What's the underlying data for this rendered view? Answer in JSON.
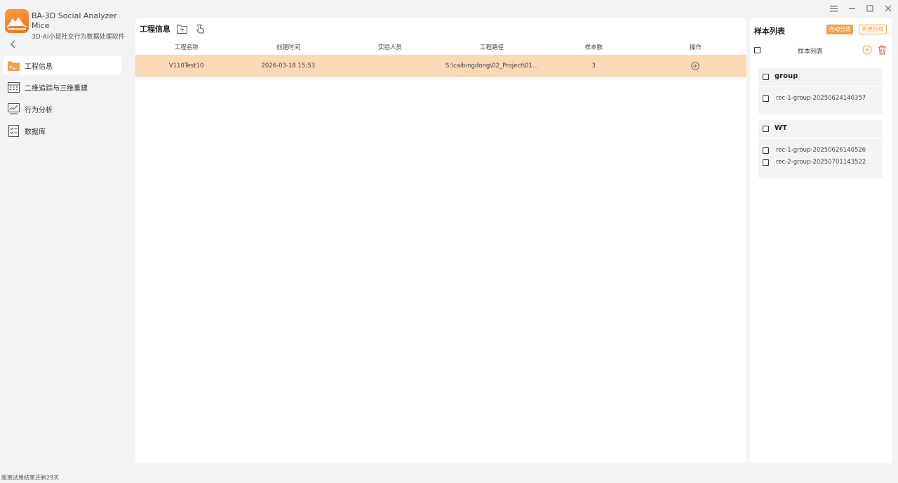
{
  "app": {
    "title": "BA-3D Social Analyzer Mice",
    "subtitle": "3D-AI小鼠社交行为数据处理软件"
  },
  "window_controls": [
    "menu-icon",
    "minimize-icon",
    "maximize-icon",
    "close-icon"
  ],
  "sidebar": {
    "items": [
      {
        "label": "工程信息",
        "icon": "terminal-folder-icon",
        "active": true
      },
      {
        "label": "二维追踪与三维重建",
        "icon": "calendar-grid-icon",
        "active": false
      },
      {
        "label": "行为分析",
        "icon": "line-chart-icon",
        "active": false
      },
      {
        "label": "数据库",
        "icon": "checklist-icon",
        "active": false
      }
    ]
  },
  "main": {
    "title": "工程信息",
    "columns": [
      "工程名称",
      "创建时间",
      "实验人员",
      "工程路径",
      "样本数",
      "操作"
    ],
    "rows": [
      {
        "name": "V110Test10",
        "created": "2026-03-18 15:53",
        "operator": "",
        "path": "S:\\caibingdong\\02_Project\\01...",
        "count": "3"
      }
    ]
  },
  "samples": {
    "title": "样本列表",
    "auto_group_label": "自动分组",
    "new_group_label": "新建分组",
    "list_header": "样本列表",
    "groups": [
      {
        "name": "group",
        "samples": [
          "rec-1-group-20250624140357"
        ]
      },
      {
        "name": "WT",
        "samples": [
          "rec-1-group-20250626140526",
          "rec-2-group-20250701143522"
        ]
      }
    ]
  },
  "status": {
    "trial_text": "距离试用结束还剩29天"
  },
  "colors": {
    "accent": "#f5a04c",
    "selected_row": "#fbd8b6",
    "delete": "#e34b4b"
  }
}
